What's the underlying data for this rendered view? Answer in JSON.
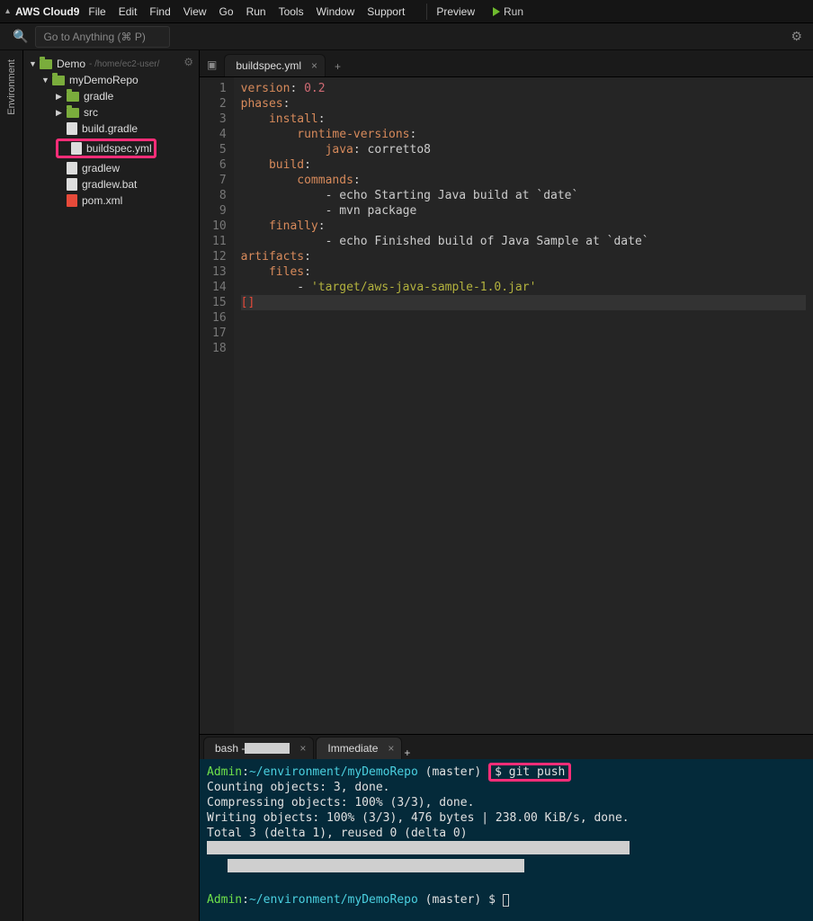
{
  "menubar": {
    "brand": "AWS Cloud9",
    "items": [
      "File",
      "Edit",
      "Find",
      "View",
      "Go",
      "Run",
      "Tools",
      "Window",
      "Support"
    ],
    "preview": "Preview",
    "run": "Run"
  },
  "toolbar": {
    "goto_placeholder": "Go to Anything (⌘ P)"
  },
  "sidebar": {
    "root": {
      "name": "Demo",
      "path": "- /home/ec2-user/"
    },
    "items": [
      {
        "type": "folder",
        "name": "myDemoRepo",
        "indent": 1,
        "expanded": true
      },
      {
        "type": "folder",
        "name": "gradle",
        "indent": 2,
        "expanded": false
      },
      {
        "type": "folder",
        "name": "src",
        "indent": 2,
        "expanded": false
      },
      {
        "type": "file",
        "name": "build.gradle",
        "indent": 2
      },
      {
        "type": "file",
        "name": "buildspec.yml",
        "indent": 2,
        "highlighted": true
      },
      {
        "type": "file",
        "name": "gradlew",
        "indent": 2
      },
      {
        "type": "file",
        "name": "gradlew.bat",
        "indent": 2
      },
      {
        "type": "file",
        "name": "pom.xml",
        "indent": 2,
        "xml": true
      }
    ]
  },
  "editor": {
    "tab": "buildspec.yml",
    "lines": [
      [
        [
          "key",
          "version"
        ],
        [
          "norm",
          ": "
        ],
        [
          "num",
          "0.2"
        ]
      ],
      [
        [
          "key",
          "phases"
        ],
        [
          "norm",
          ":"
        ]
      ],
      [
        [
          "norm",
          "    "
        ],
        [
          "key",
          "install"
        ],
        [
          "norm",
          ":"
        ]
      ],
      [
        [
          "norm",
          "        "
        ],
        [
          "key",
          "runtime-versions"
        ],
        [
          "norm",
          ":"
        ]
      ],
      [
        [
          "norm",
          "            "
        ],
        [
          "key",
          "java"
        ],
        [
          "norm",
          ": corretto8"
        ]
      ],
      [],
      [
        [
          "norm",
          "    "
        ],
        [
          "key",
          "build"
        ],
        [
          "norm",
          ":"
        ]
      ],
      [
        [
          "norm",
          "        "
        ],
        [
          "key",
          "commands"
        ],
        [
          "norm",
          ":"
        ]
      ],
      [
        [
          "norm",
          "            - echo Starting Java build at `date`"
        ]
      ],
      [
        [
          "norm",
          "            - mvn package"
        ]
      ],
      [],
      [
        [
          "norm",
          "    "
        ],
        [
          "key",
          "finally"
        ],
        [
          "norm",
          ":"
        ]
      ],
      [
        [
          "norm",
          "            - echo Finished build of Java Sample at `date`"
        ]
      ],
      [],
      [
        [
          "key",
          "artifacts"
        ],
        [
          "norm",
          ":"
        ]
      ],
      [
        [
          "norm",
          "    "
        ],
        [
          "key",
          "files"
        ],
        [
          "norm",
          ":"
        ]
      ],
      [
        [
          "norm",
          "        - "
        ],
        [
          "str",
          "'target/aws-java-sample-1.0.jar'"
        ]
      ],
      [
        [
          "br",
          "[]"
        ]
      ]
    ]
  },
  "bottom": {
    "tabs": [
      "bash - ",
      "Immediate"
    ]
  },
  "terminal": {
    "prompt_user": "Admin",
    "prompt_path": "~/environment/myDemoRepo",
    "prompt_branch": "(master)",
    "cmd": "$ git push",
    "lines": [
      "Counting objects: 3, done.",
      "Compressing objects: 100% (3/3), done.",
      "Writing objects: 100% (3/3), 476 bytes | 238.00 KiB/s, done.",
      "Total 3 (delta 1), reused 0 (delta 0)"
    ]
  }
}
